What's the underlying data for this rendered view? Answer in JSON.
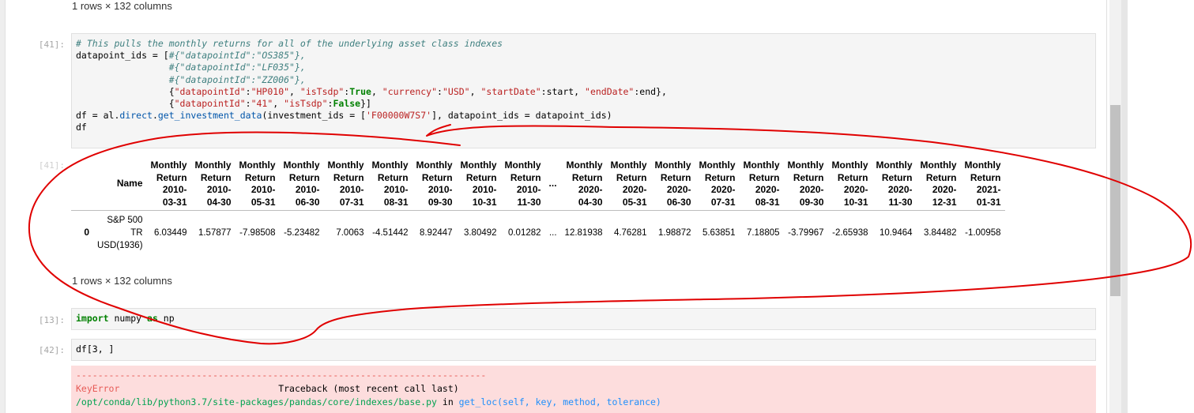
{
  "prev_output": {
    "summary": "1 rows × 132 columns"
  },
  "cell_41": {
    "in_prompt": "[41]:",
    "out_prompt": "[41]:",
    "code_lines": [
      [
        {
          "t": "# This pulls the monthly returns for all of the underlying asset class indexes",
          "c": "cm"
        }
      ],
      [
        {
          "t": "datapoint_ids = [",
          "c": ""
        },
        {
          "t": "#{\"datapointId\":\"OS385\"},",
          "c": "cm"
        }
      ],
      [
        {
          "t": "                 ",
          "c": ""
        },
        {
          "t": "#{\"datapointId\":\"LF035\"},",
          "c": "cm"
        }
      ],
      [
        {
          "t": "                 ",
          "c": ""
        },
        {
          "t": "#{\"datapointId\":\"ZZ006\"},",
          "c": "cm"
        }
      ],
      [
        {
          "t": "                 {",
          "c": ""
        },
        {
          "t": "\"datapointId\"",
          "c": "st"
        },
        {
          "t": ":",
          "c": ""
        },
        {
          "t": "\"HP010\"",
          "c": "st"
        },
        {
          "t": ", ",
          "c": ""
        },
        {
          "t": "\"isTsdp\"",
          "c": "st"
        },
        {
          "t": ":",
          "c": ""
        },
        {
          "t": "True",
          "c": "kw"
        },
        {
          "t": ", ",
          "c": ""
        },
        {
          "t": "\"currency\"",
          "c": "st"
        },
        {
          "t": ":",
          "c": ""
        },
        {
          "t": "\"USD\"",
          "c": "st"
        },
        {
          "t": ", ",
          "c": ""
        },
        {
          "t": "\"startDate\"",
          "c": "st"
        },
        {
          "t": ":start, ",
          "c": ""
        },
        {
          "t": "\"endDate\"",
          "c": "st"
        },
        {
          "t": ":end},",
          "c": ""
        }
      ],
      [
        {
          "t": "                 {",
          "c": ""
        },
        {
          "t": "\"datapointId\"",
          "c": "st"
        },
        {
          "t": ":",
          "c": ""
        },
        {
          "t": "\"41\"",
          "c": "st"
        },
        {
          "t": ", ",
          "c": ""
        },
        {
          "t": "\"isTsdp\"",
          "c": "st"
        },
        {
          "t": ":",
          "c": ""
        },
        {
          "t": "False",
          "c": "kw"
        },
        {
          "t": "}]",
          "c": ""
        }
      ],
      [
        {
          "t": "df = al.",
          "c": ""
        },
        {
          "t": "direct",
          "c": "attr"
        },
        {
          "t": ".",
          "c": ""
        },
        {
          "t": "get_investment_data",
          "c": "attr"
        },
        {
          "t": "(investment_ids = [",
          "c": ""
        },
        {
          "t": "'F00000W7S7'",
          "c": "st"
        },
        {
          "t": "], datapoint_ids = datapoint_ids)",
          "c": ""
        }
      ],
      [
        {
          "t": "df",
          "c": ""
        }
      ]
    ],
    "table": {
      "name_header": "Name",
      "columns": [
        [
          "Monthly",
          "Return",
          "2010-",
          "03-31"
        ],
        [
          "Monthly",
          "Return",
          "2010-",
          "04-30"
        ],
        [
          "Monthly",
          "Return",
          "2010-",
          "05-31"
        ],
        [
          "Monthly",
          "Return",
          "2010-",
          "06-30"
        ],
        [
          "Monthly",
          "Return",
          "2010-",
          "07-31"
        ],
        [
          "Monthly",
          "Return",
          "2010-",
          "08-31"
        ],
        [
          "Monthly",
          "Return",
          "2010-",
          "09-30"
        ],
        [
          "Monthly",
          "Return",
          "2010-",
          "10-31"
        ],
        [
          "Monthly",
          "Return",
          "2010-",
          "11-30"
        ],
        [
          "..."
        ],
        [
          "Monthly",
          "Return",
          "2020-",
          "04-30"
        ],
        [
          "Monthly",
          "Return",
          "2020-",
          "05-31"
        ],
        [
          "Monthly",
          "Return",
          "2020-",
          "06-30"
        ],
        [
          "Monthly",
          "Return",
          "2020-",
          "07-31"
        ],
        [
          "Monthly",
          "Return",
          "2020-",
          "08-31"
        ],
        [
          "Monthly",
          "Return",
          "2020-",
          "09-30"
        ],
        [
          "Monthly",
          "Return",
          "2020-",
          "10-31"
        ],
        [
          "Monthly",
          "Return",
          "2020-",
          "11-30"
        ],
        [
          "Monthly",
          "Return",
          "2020-",
          "12-31"
        ],
        [
          "Monthly",
          "Return",
          "2021-",
          "01-31"
        ]
      ],
      "rows": [
        {
          "index": "0",
          "name": [
            "S&P 500",
            "TR",
            "USD(1936)"
          ],
          "values": [
            "6.03449",
            "1.57877",
            "-7.98508",
            "-5.23482",
            "7.0063",
            "-4.51442",
            "8.92447",
            "3.80492",
            "0.01282",
            "...",
            "12.81938",
            "4.76281",
            "1.98872",
            "5.63851",
            "7.18805",
            "-3.79967",
            "-2.65938",
            "10.9464",
            "3.84482",
            "-1.00958"
          ]
        }
      ],
      "summary": "1 rows × 132 columns"
    }
  },
  "cell_13": {
    "in_prompt": "[13]:",
    "code_lines": [
      [
        {
          "t": "import",
          "c": "kw"
        },
        {
          "t": " numpy ",
          "c": ""
        },
        {
          "t": "as",
          "c": "kw"
        },
        {
          "t": " np",
          "c": ""
        }
      ]
    ]
  },
  "cell_42": {
    "in_prompt": "[42]:",
    "code_lines": [
      [
        {
          "t": "df[3, ]",
          "c": ""
        }
      ]
    ],
    "error": {
      "dashes": "---------------------------------------------------------------------------",
      "error_name": "KeyError",
      "traceback_label": "Traceback (most recent call last)",
      "file_path": "/opt/conda/lib/python3.7/site-packages/pandas/core/indexes/base.py",
      "in_word": " in ",
      "func_sig": "get_loc(self, key, method, tolerance)"
    }
  },
  "colors": {
    "annotation_stroke": "#e00000",
    "error_background": "#fddddd",
    "code_background": "#f5f5f5"
  }
}
